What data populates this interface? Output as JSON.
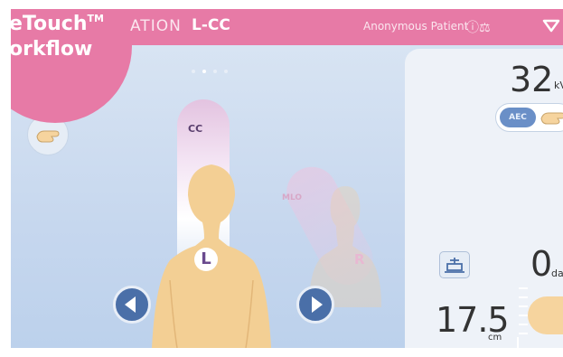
{
  "badge": {
    "line1": "eTouch",
    "trademark": "TM",
    "line2": "orkflow"
  },
  "header": {
    "mode": "ATION",
    "view": "L-CC",
    "patient": "Anonymous Patient",
    "status_icons": "ⓘ⚖",
    "menu_icon": "triangle-down-icon"
  },
  "views": {
    "cc_label": "CC",
    "mlo_label": "MLO",
    "left_label": "L",
    "right_label": "R",
    "page_indicator": {
      "count": 4,
      "active": 1
    }
  },
  "exposure": {
    "kv_value": "32",
    "kv_unit": "kV",
    "aec_label": "AEC"
  },
  "dose": {
    "value": "0",
    "unit": "dan"
  },
  "thickness": {
    "value": "17.5",
    "unit": "cm"
  },
  "colors": {
    "brand_pink": "#e77aa6",
    "accent_blue": "#4a6fa8",
    "skin": "#f6d49e",
    "background": "#c6d7ee"
  }
}
